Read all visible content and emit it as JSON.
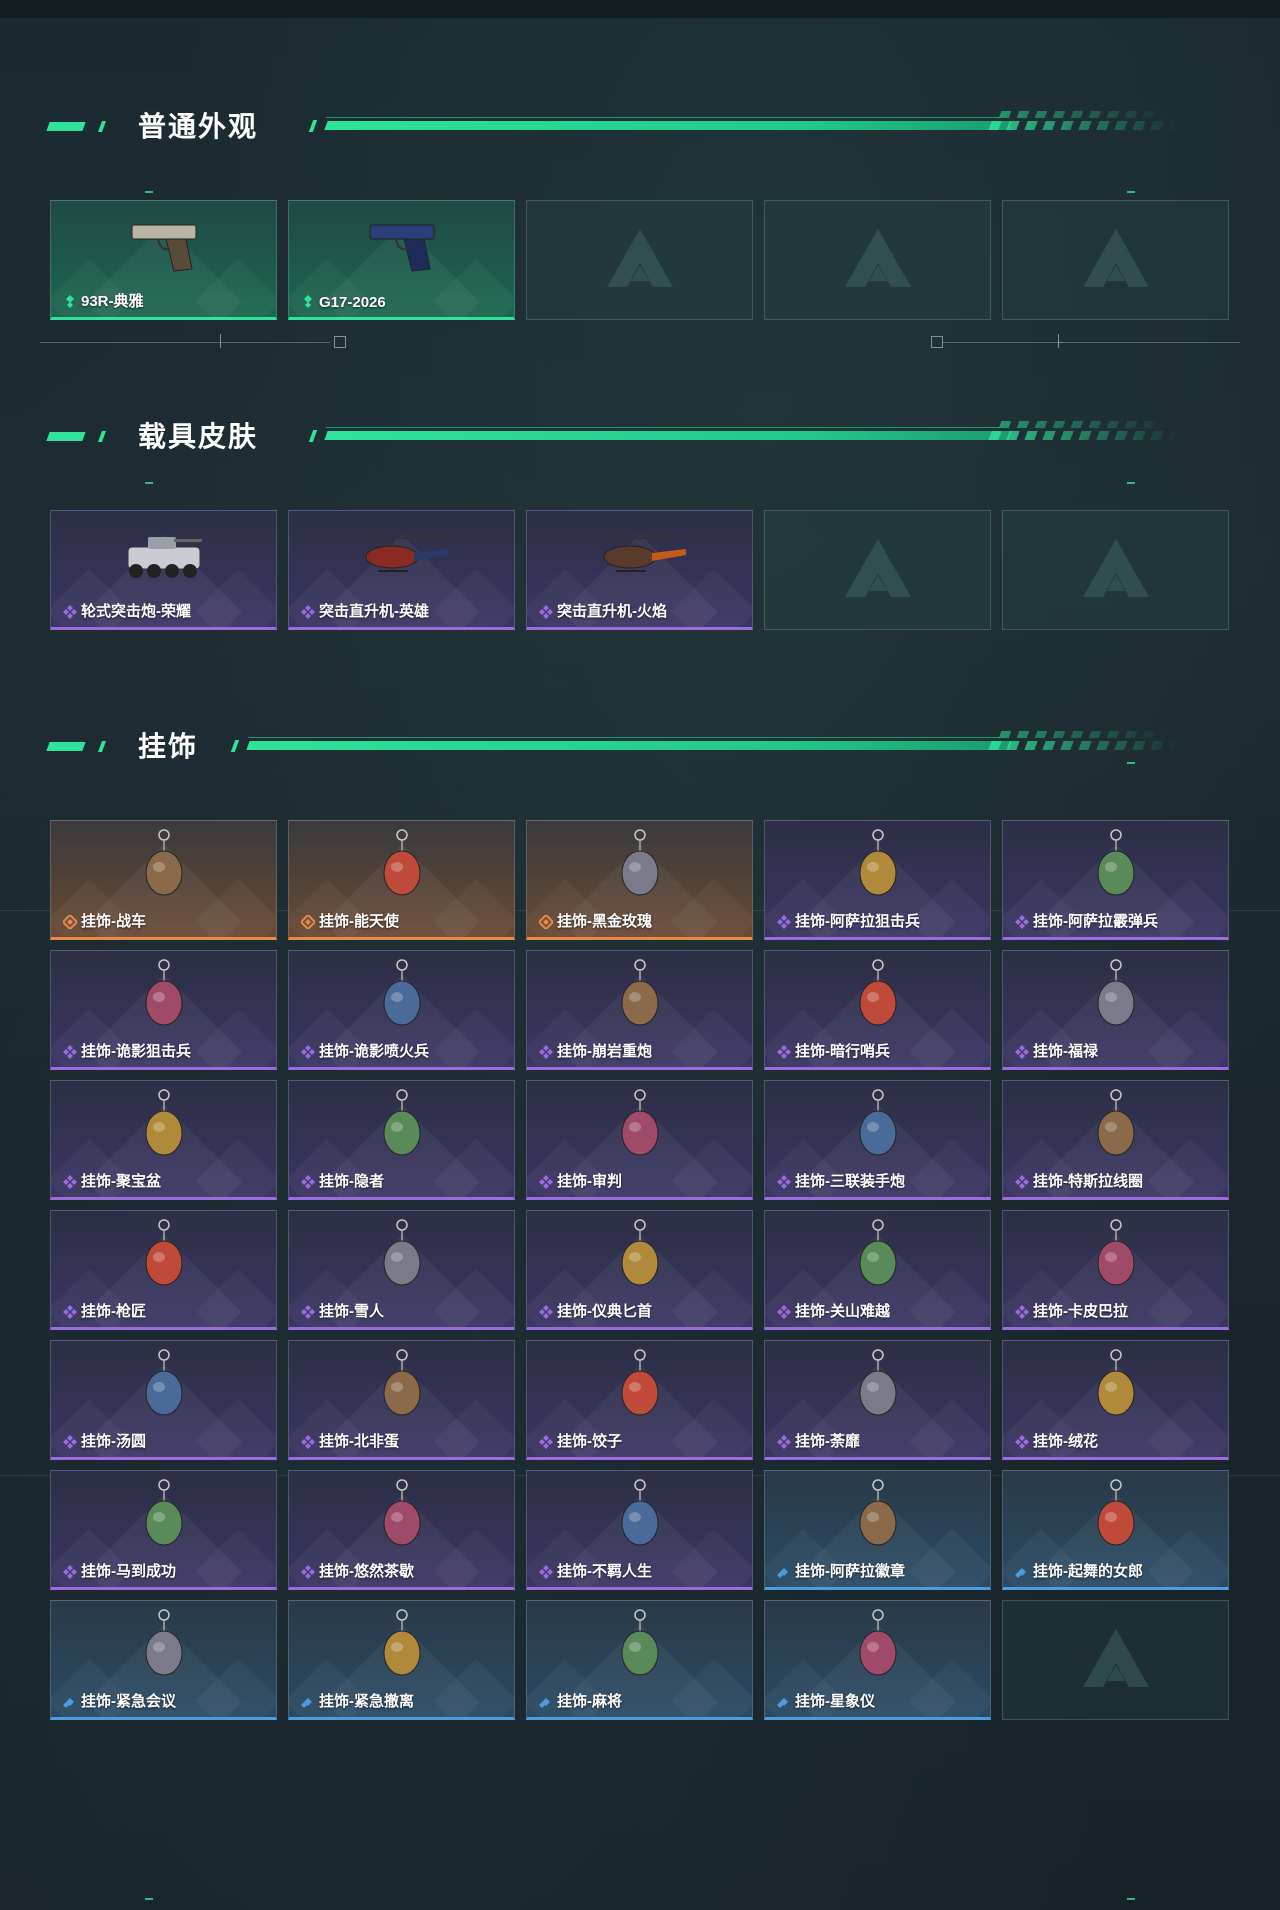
{
  "sections": [
    {
      "title": "普通外观",
      "items": [
        {
          "label": "93R-典雅",
          "rarity": "green",
          "icon": "pistol-icon"
        },
        {
          "label": "G17-2026",
          "rarity": "green",
          "icon": "pistol-icon"
        },
        {
          "label": "",
          "rarity": "empty",
          "icon": "delta-logo-icon"
        },
        {
          "label": "",
          "rarity": "empty",
          "icon": "delta-logo-icon"
        },
        {
          "label": "",
          "rarity": "empty",
          "icon": "delta-logo-icon"
        }
      ]
    },
    {
      "title": "载具皮肤",
      "items": [
        {
          "label": "轮式突击炮-荣耀",
          "rarity": "purple",
          "icon": "armored-vehicle-icon"
        },
        {
          "label": "突击直升机-英雄",
          "rarity": "purple",
          "icon": "helicopter-icon"
        },
        {
          "label": "突击直升机-火焰",
          "rarity": "purple",
          "icon": "helicopter-icon"
        },
        {
          "label": "",
          "rarity": "empty",
          "icon": "delta-logo-icon"
        },
        {
          "label": "",
          "rarity": "empty",
          "icon": "delta-logo-icon"
        }
      ]
    },
    {
      "title": "挂饰",
      "items": [
        {
          "label": "挂饰-战车",
          "rarity": "orange",
          "icon": "charm-icon"
        },
        {
          "label": "挂饰-能天使",
          "rarity": "orange",
          "icon": "charm-icon"
        },
        {
          "label": "挂饰-黑金玫瑰",
          "rarity": "orange",
          "icon": "charm-icon"
        },
        {
          "label": "挂饰-阿萨拉狙击兵",
          "rarity": "purple",
          "icon": "charm-icon"
        },
        {
          "label": "挂饰-阿萨拉霰弹兵",
          "rarity": "purple",
          "icon": "charm-icon"
        },
        {
          "label": "挂饰-诡影狙击兵",
          "rarity": "purple",
          "icon": "charm-icon"
        },
        {
          "label": "挂饰-诡影喷火兵",
          "rarity": "purple",
          "icon": "charm-icon"
        },
        {
          "label": "挂饰-崩岩重炮",
          "rarity": "purple",
          "icon": "charm-icon"
        },
        {
          "label": "挂饰-暗行哨兵",
          "rarity": "purple",
          "icon": "charm-icon"
        },
        {
          "label": "挂饰-福禄",
          "rarity": "purple",
          "icon": "charm-icon"
        },
        {
          "label": "挂饰-聚宝盆",
          "rarity": "purple",
          "icon": "charm-icon"
        },
        {
          "label": "挂饰-隐者",
          "rarity": "purple",
          "icon": "charm-icon"
        },
        {
          "label": "挂饰-审判",
          "rarity": "purple",
          "icon": "charm-icon"
        },
        {
          "label": "挂饰-三联装手炮",
          "rarity": "purple",
          "icon": "charm-icon"
        },
        {
          "label": "挂饰-特斯拉线圈",
          "rarity": "purple",
          "icon": "charm-icon"
        },
        {
          "label": "挂饰-枪匠",
          "rarity": "purple",
          "icon": "charm-icon"
        },
        {
          "label": "挂饰-雪人",
          "rarity": "purple",
          "icon": "charm-icon"
        },
        {
          "label": "挂饰-仪典匕首",
          "rarity": "purple",
          "icon": "charm-icon"
        },
        {
          "label": "挂饰-关山难越",
          "rarity": "purple",
          "icon": "charm-icon"
        },
        {
          "label": "挂饰-卡皮巴拉",
          "rarity": "purple",
          "icon": "charm-icon"
        },
        {
          "label": "挂饰-汤圆",
          "rarity": "purple",
          "icon": "charm-icon"
        },
        {
          "label": "挂饰-北非蛋",
          "rarity": "purple",
          "icon": "charm-icon"
        },
        {
          "label": "挂饰-饺子",
          "rarity": "purple",
          "icon": "charm-icon"
        },
        {
          "label": "挂饰-荼靡",
          "rarity": "purple",
          "icon": "charm-icon"
        },
        {
          "label": "挂饰-绒花",
          "rarity": "purple",
          "icon": "charm-icon"
        },
        {
          "label": "挂饰-马到成功",
          "rarity": "purple",
          "icon": "charm-icon"
        },
        {
          "label": "挂饰-悠然茶歇",
          "rarity": "purple",
          "icon": "charm-icon"
        },
        {
          "label": "挂饰-不羁人生",
          "rarity": "purple",
          "icon": "charm-icon"
        },
        {
          "label": "挂饰-阿萨拉徽章",
          "rarity": "blue",
          "icon": "charm-icon"
        },
        {
          "label": "挂饰-起舞的女郎",
          "rarity": "blue",
          "icon": "charm-icon"
        },
        {
          "label": "挂饰-紧急会议",
          "rarity": "blue",
          "icon": "charm-icon"
        },
        {
          "label": "挂饰-紧急撤离",
          "rarity": "blue",
          "icon": "charm-icon"
        },
        {
          "label": "挂饰-麻将",
          "rarity": "blue",
          "icon": "charm-icon"
        },
        {
          "label": "挂饰-星象仪",
          "rarity": "blue",
          "icon": "charm-icon"
        },
        {
          "label": "",
          "rarity": "empty",
          "icon": "delta-logo-icon"
        }
      ]
    }
  ],
  "colors": {
    "accent": "#2fe39a",
    "green": "#2fe39a",
    "purple": "#9b6be0",
    "orange": "#e8894a",
    "blue": "#4d9be0"
  }
}
